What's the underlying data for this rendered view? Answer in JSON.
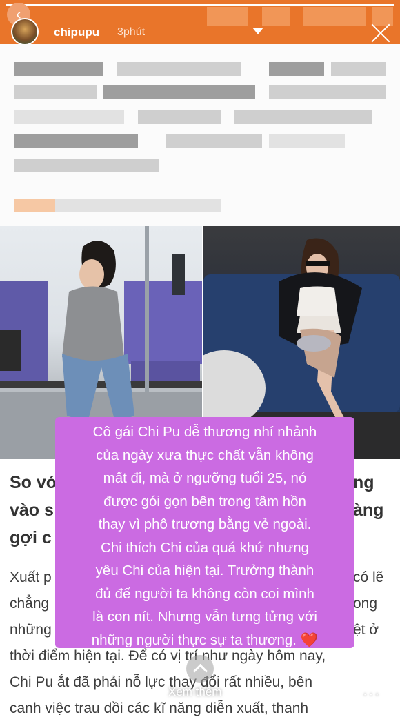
{
  "story": {
    "progress": 1.0,
    "username": "chipupu",
    "time": "3phút",
    "accent": "#e9752a"
  },
  "caption": {
    "line1": "Cô gái Chi Pu dễ thương nhí nhảnh",
    "line2": "của ngày xưa thực chất vẫn không",
    "line3": "mất đi, mà ở ngưỡng tuổi 25, nó",
    "line4": "được gói gọn bên trong tâm hồn",
    "line5": "thay vì phô trương bằng vẻ ngoài.",
    "line6": "Chi thích Chi của quá khứ nhưng",
    "line7": "yêu Chi của hiện tại. Trưởng thành",
    "line8": "đủ để người ta không còn coi mình",
    "line9": "là con nít. Nhưng vẫn tưng tửng với",
    "line10": "những người thực sự ta thương.",
    "heart": "❤️",
    "bg_color": "#cb6be2"
  },
  "article": {
    "h1_left": "So vớ",
    "h1_right": "ng",
    "h2_left": "vào s",
    "h2_right": "àng",
    "h3_left": "gợi c",
    "p1_left": "Xuất p",
    "p1_right": "có lẽ",
    "p2_left": "chẳng",
    "p2_right": "ong",
    "p3_left": "những",
    "p3_right": "ệt ở",
    "p4": "thời điểm hiện tại. Để có vị trí như ngày hôm nay,",
    "p5": "Chi Pu ắt đã phải nỗ lực thay đổi rất nhiều, bên",
    "p6": "canh việc trau dồi các kĩ năng diễn xuất, thanh"
  },
  "footer": {
    "see_more": "Xem thêm",
    "send_icon": "send-icon",
    "more_icon": "more-icon"
  }
}
